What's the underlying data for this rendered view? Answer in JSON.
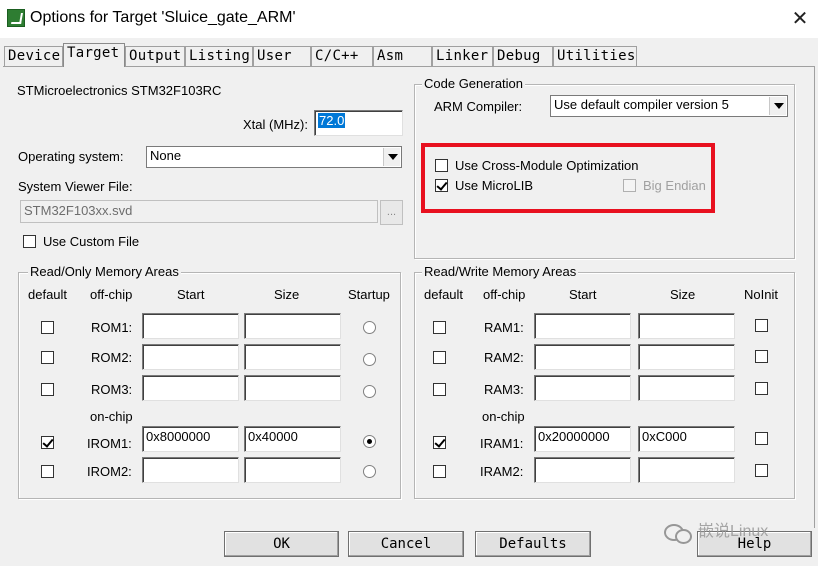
{
  "window": {
    "title": "Options for Target 'Sluice_gate_ARM'",
    "close": "✕"
  },
  "tabs": [
    "Device",
    "Target",
    "Output",
    "Listing",
    "User",
    "C/C++",
    "Asm",
    "Linker",
    "Debug",
    "Utilities"
  ],
  "active_tab": "Target",
  "device": {
    "name": "STMicroelectronics STM32F103RC",
    "xtal_label": "Xtal (MHz):",
    "xtal_value": "72.0",
    "os_label": "Operating system:",
    "os_value": "None",
    "svd_label": "System Viewer File:",
    "svd_value": "STM32F103xx.svd",
    "browse": "...",
    "custom_file_label": "Use Custom File",
    "custom_file_checked": false
  },
  "code_generation": {
    "title": "Code Generation",
    "compiler_label": "ARM Compiler:",
    "compiler_value": "Use default compiler version 5",
    "cross_module_label": "Use Cross-Module Optimization",
    "cross_module_checked": false,
    "microlib_label": "Use MicroLIB",
    "microlib_checked": true,
    "big_endian_label": "Big Endian",
    "big_endian_checked": false,
    "highlight_color": "#e8101f"
  },
  "ro_memory": {
    "title": "Read/Only Memory Areas",
    "headers": {
      "default": "default",
      "offchip": "off-chip",
      "start": "Start",
      "size": "Size",
      "last": "Startup"
    },
    "onchip_label": "on-chip",
    "rows": [
      {
        "label": "ROM1:",
        "default": false,
        "start": "",
        "size": "",
        "last": false
      },
      {
        "label": "ROM2:",
        "default": false,
        "start": "",
        "size": "",
        "last": false
      },
      {
        "label": "ROM3:",
        "default": false,
        "start": "",
        "size": "",
        "last": false
      },
      {
        "label": "IROM1:",
        "default": true,
        "start": "0x8000000",
        "size": "0x40000",
        "last": true
      },
      {
        "label": "IROM2:",
        "default": false,
        "start": "",
        "size": "",
        "last": false
      }
    ]
  },
  "rw_memory": {
    "title": "Read/Write Memory Areas",
    "headers": {
      "default": "default",
      "offchip": "off-chip",
      "start": "Start",
      "size": "Size",
      "last": "NoInit"
    },
    "onchip_label": "on-chip",
    "rows": [
      {
        "label": "RAM1:",
        "default": false,
        "start": "",
        "size": "",
        "last": false
      },
      {
        "label": "RAM2:",
        "default": false,
        "start": "",
        "size": "",
        "last": false
      },
      {
        "label": "RAM3:",
        "default": false,
        "start": "",
        "size": "",
        "last": false
      },
      {
        "label": "IRAM1:",
        "default": true,
        "start": "0x20000000",
        "size": "0xC000",
        "last": false
      },
      {
        "label": "IRAM2:",
        "default": false,
        "start": "",
        "size": "",
        "last": false
      }
    ]
  },
  "buttons": {
    "ok": "OK",
    "cancel": "Cancel",
    "defaults": "Defaults",
    "help": "Help"
  },
  "watermark": {
    "text": "嵌说Linux",
    "icon": "wechat-icon"
  }
}
